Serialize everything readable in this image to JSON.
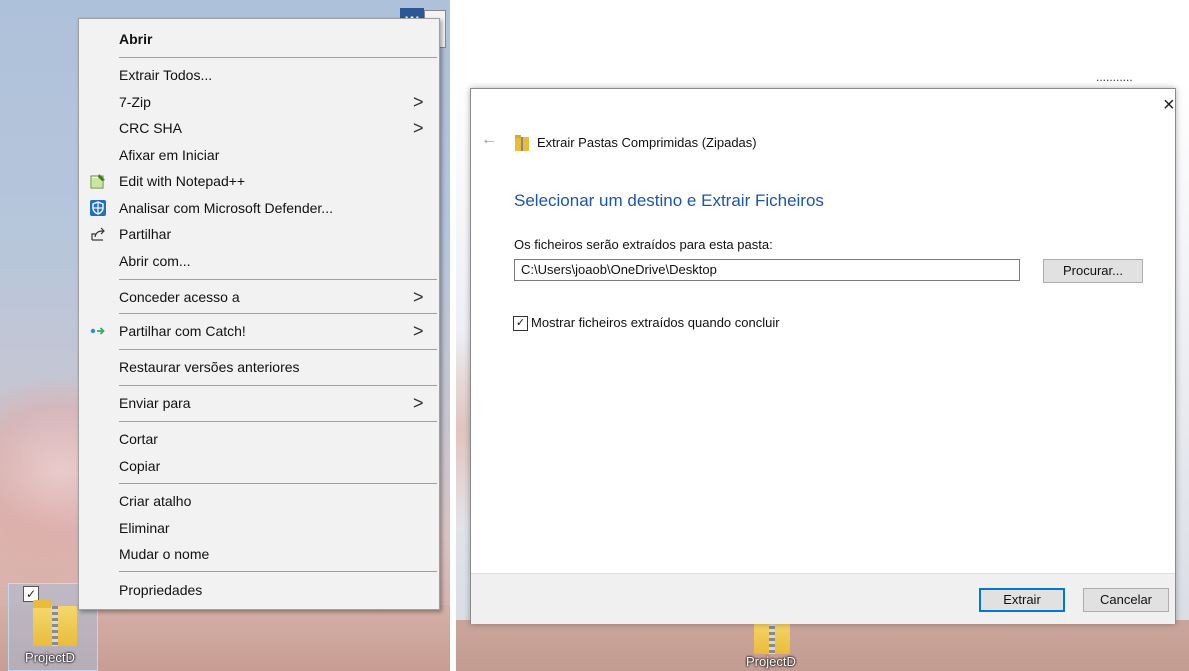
{
  "context_menu": {
    "items": [
      {
        "label": "Abrir"
      },
      {
        "label": "Extrair Todos..."
      },
      {
        "label": "7-Zip"
      },
      {
        "label": "CRC SHA"
      },
      {
        "label": "Afixar em Iniciar"
      },
      {
        "label": "Edit with Notepad++"
      },
      {
        "label": "Analisar com Microsoft Defender..."
      },
      {
        "label": "Partilhar"
      },
      {
        "label": "Abrir com..."
      },
      {
        "label": "Conceder acesso a"
      },
      {
        "label": "Partilhar com Catch!"
      },
      {
        "label": "Restaurar versões anteriores"
      },
      {
        "label": "Enviar para"
      },
      {
        "label": "Cortar"
      },
      {
        "label": "Copiar"
      },
      {
        "label": "Criar atalho"
      },
      {
        "label": "Eliminar"
      },
      {
        "label": "Mudar o nome"
      },
      {
        "label": "Propriedades"
      }
    ],
    "submenu_arrow": ">"
  },
  "desktop": {
    "folder_name": "ProjectD",
    "word_icon_letter": "W",
    "top_right_text": "..........."
  },
  "dialog": {
    "back_arrow": "←",
    "close_glyph": "×",
    "window_title": "Extrair Pastas Comprimidas (Zipadas)",
    "heading": "Selecionar um destino e Extrair Ficheiros",
    "folder_label": "Os ficheiros serão extraídos para esta pasta:",
    "path_value": "C:\\Users\\joaob\\OneDrive\\Desktop",
    "browse_button": "Procurar...",
    "show_files_checkbox": {
      "label": "Mostrar ficheiros extraídos quando concluir",
      "checked": true
    },
    "extract_button": "Extrair",
    "cancel_button": "Cancelar"
  },
  "colors": {
    "heading_blue": "#1a56b0",
    "button_focus": "#0078d7",
    "folder_yellow": "#e9bc3c"
  }
}
